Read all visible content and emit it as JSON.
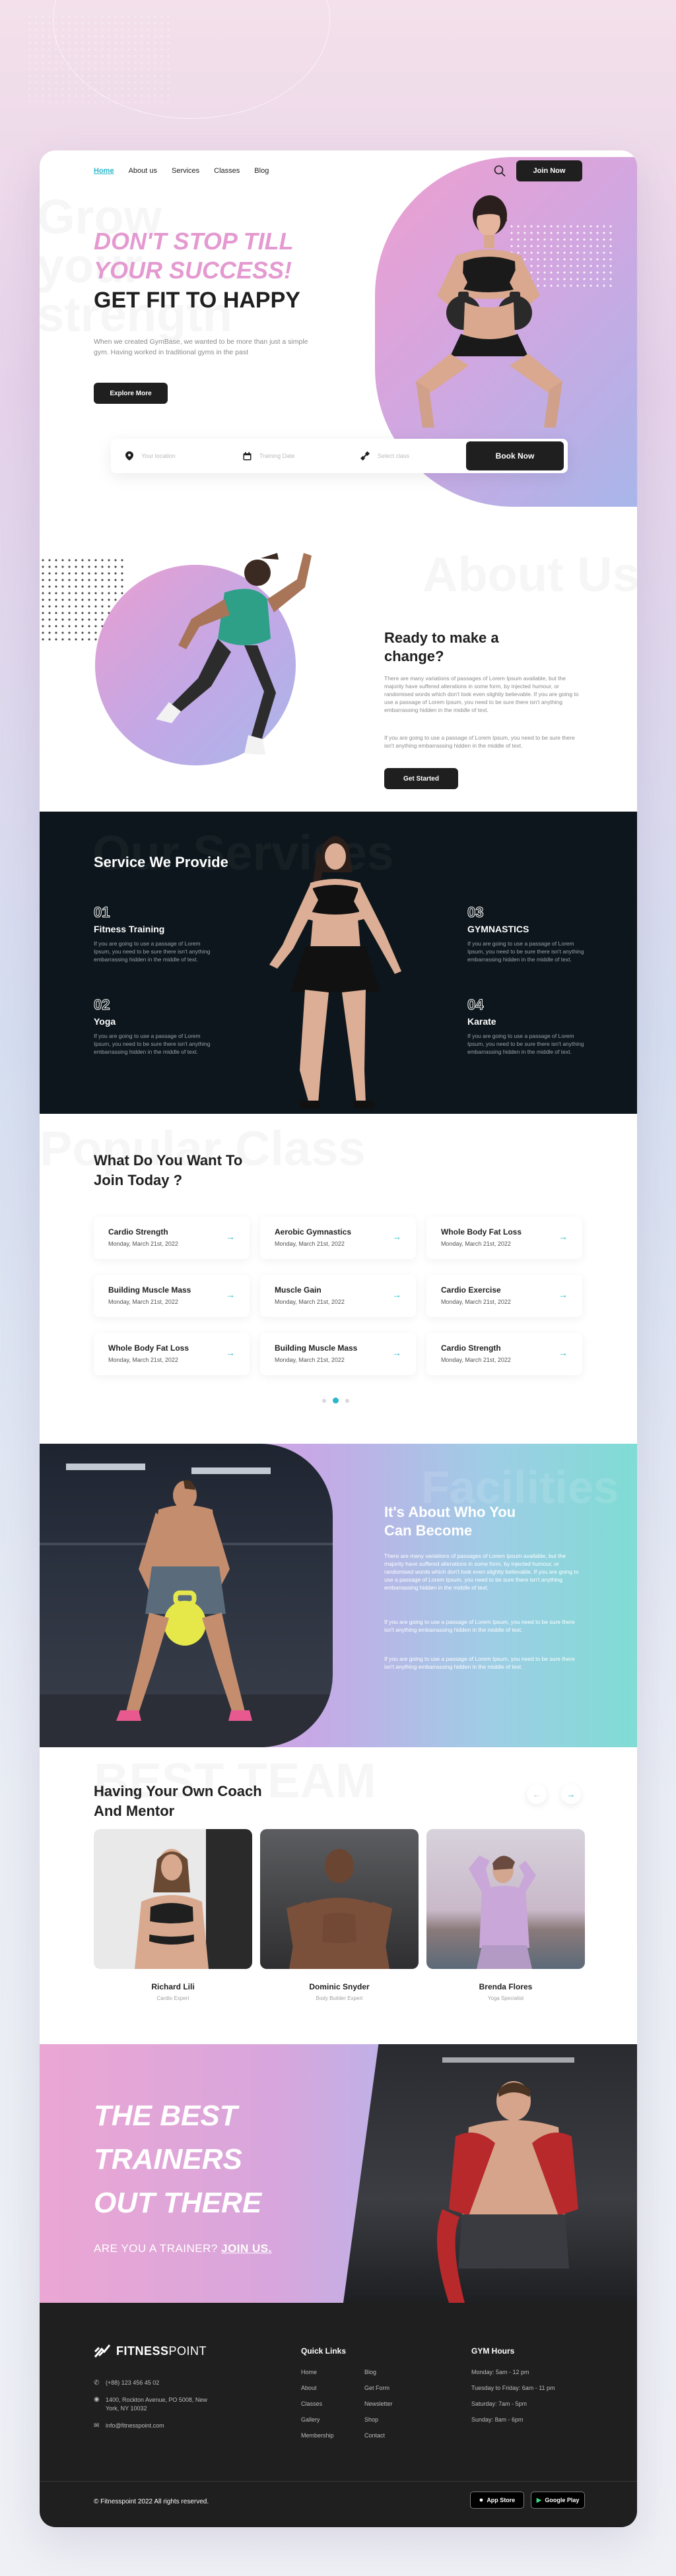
{
  "nav": {
    "items": [
      "Home",
      "About us",
      "Services",
      "Classes",
      "Blog"
    ],
    "join_label": "Join Now"
  },
  "hero": {
    "ghost": [
      "Grow",
      "your",
      "strength"
    ],
    "line1": "DON'T STOP TILL",
    "line2": "YOUR SUCCESS!",
    "line3": "GET FIT TO HAPPY",
    "text": "When we created GymBase, we wanted to be more than just a simple gym. Having worked in traditional gyms in the past",
    "cta": "Explore More"
  },
  "booking": {
    "location_placeholder": "Your location",
    "date_placeholder": "Training Date",
    "class_placeholder": "Select class",
    "cta": "Book Now"
  },
  "about": {
    "ghost": "About Us",
    "title_line1": "Ready to make a",
    "title_line2": "change?",
    "p1": "There are many variations of passages of Lorem Ipsum available, but the majority have suffered alterations in some form, by injected humour, or randomised words which don't look even slightly believable. If you are going to use a passage of Lorem Ipsum, you need to be sure there isn't anything embarrassing hidden in the middle of text.",
    "p2": "If you are going to use a passage of Lorem Ipsum, you need to be sure there isn't anything embarrassing hidden in the middle of text.",
    "cta": "Get Started"
  },
  "services": {
    "ghost": "Our Services",
    "title": "Service We Provide",
    "items": [
      {
        "num": "01",
        "name": "Fitness Training",
        "text": "If you are going to use a passage of Lorem Ipsum, you need to be sure there isn't anything embarrassing hidden in the middle of text."
      },
      {
        "num": "02",
        "name": "Yoga",
        "text": "If you are going to use a passage of Lorem Ipsum, you need to be sure there isn't anything embarrassing hidden in the middle of text."
      },
      {
        "num": "03",
        "name": "GYMNASTICS",
        "text": "If you are going to use a passage of Lorem Ipsum, you need to be sure there isn't anything embarrassing hidden in the middle of text."
      },
      {
        "num": "04",
        "name": "Karate",
        "text": "If you are going to use a passage of Lorem Ipsum, you need to be sure there isn't anything embarrassing hidden in the middle of text."
      }
    ]
  },
  "classes": {
    "ghost": "Popular Class",
    "title_line1": "What Do You Want To",
    "title_line2": "Join Today ?",
    "cards": [
      {
        "title": "Cardio Strength",
        "date": "Monday, March 21st, 2022"
      },
      {
        "title": "Aerobic Gymnastics",
        "date": "Monday, March 21st, 2022"
      },
      {
        "title": "Whole Body Fat Loss",
        "date": "Monday, March 21st, 2022"
      },
      {
        "title": "Building Muscle Mass",
        "date": "Monday, March 21st, 2022"
      },
      {
        "title": "Muscle Gain",
        "date": "Monday, March 21st, 2022"
      },
      {
        "title": "Cardio Exercise",
        "date": "Monday, March 21st, 2022"
      },
      {
        "title": "Whole Body Fat Loss",
        "date": "Monday, March 21st, 2022"
      },
      {
        "title": "Building Muscle Mass",
        "date": "Monday, March 21st, 2022"
      },
      {
        "title": "Cardio Strength",
        "date": "Monday, March 21st, 2022"
      }
    ]
  },
  "facilities": {
    "ghost": "Facilities",
    "title_line1": "It's About Who You",
    "title_line2": "Can Become",
    "p1": "There are many variations of passages of Lorem Ipsum available, but the majority have suffered alterations in some form, by injected humour, or randomised words which don't look even slightly believable. If you are going to use a passage of Lorem Ipsum, you need to be sure there isn't anything embarrassing hidden in the middle of text.",
    "p2": "If you are going to use a passage of Lorem Ipsum, you need to be sure there isn't anything embarrassing hidden in the middle of text.",
    "p3": "If you are going to use a passage of Lorem Ipsum, you need to be sure there isn't anything embarrassing hidden in the middle of text."
  },
  "team": {
    "ghost": "BEST TEAM",
    "title_line1": "Having Your Own Coach",
    "title_line2": "And Mentor",
    "members": [
      {
        "name": "Richard Lili",
        "role": "Cardio Expert"
      },
      {
        "name": "Dominic Snyder",
        "role": "Body Builder Expert"
      },
      {
        "name": "Brenda Flores",
        "role": "Yoga Specialist"
      }
    ]
  },
  "trainers": {
    "line1": "THE BEST",
    "line2": "TRAINERS",
    "line3": "OUT THERE",
    "question": "ARE YOU A TRAINER?",
    "link": "JOIN US."
  },
  "footer": {
    "brand_bold": "FITNESS",
    "brand_light": "POINT",
    "phone": "(+88) 123 456 45 02",
    "address": "1400, Rockton Avenue, PO 5008, New York, NY 10032",
    "email": "info@fitnesspoint.com",
    "quick_links_title": "Quick Links",
    "links_col1": [
      "Home",
      "About",
      "Classes",
      "Gallery",
      "Membership"
    ],
    "links_col2": [
      "Blog",
      "Get Form",
      "Newsletter",
      "Shop",
      "Contact"
    ],
    "hours_title": "GYM Hours",
    "hours": [
      "Monday: 5am - 12 pm",
      "Tuesday to Friday: 6am - 11 pm",
      "Saturday: 7am - 5pm",
      "Sunday: 8am - 6pm"
    ],
    "copyright": "© Fitnesspoint 2022 All rights reserved.",
    "app_store": "App Store",
    "google_play": "Google Play"
  }
}
